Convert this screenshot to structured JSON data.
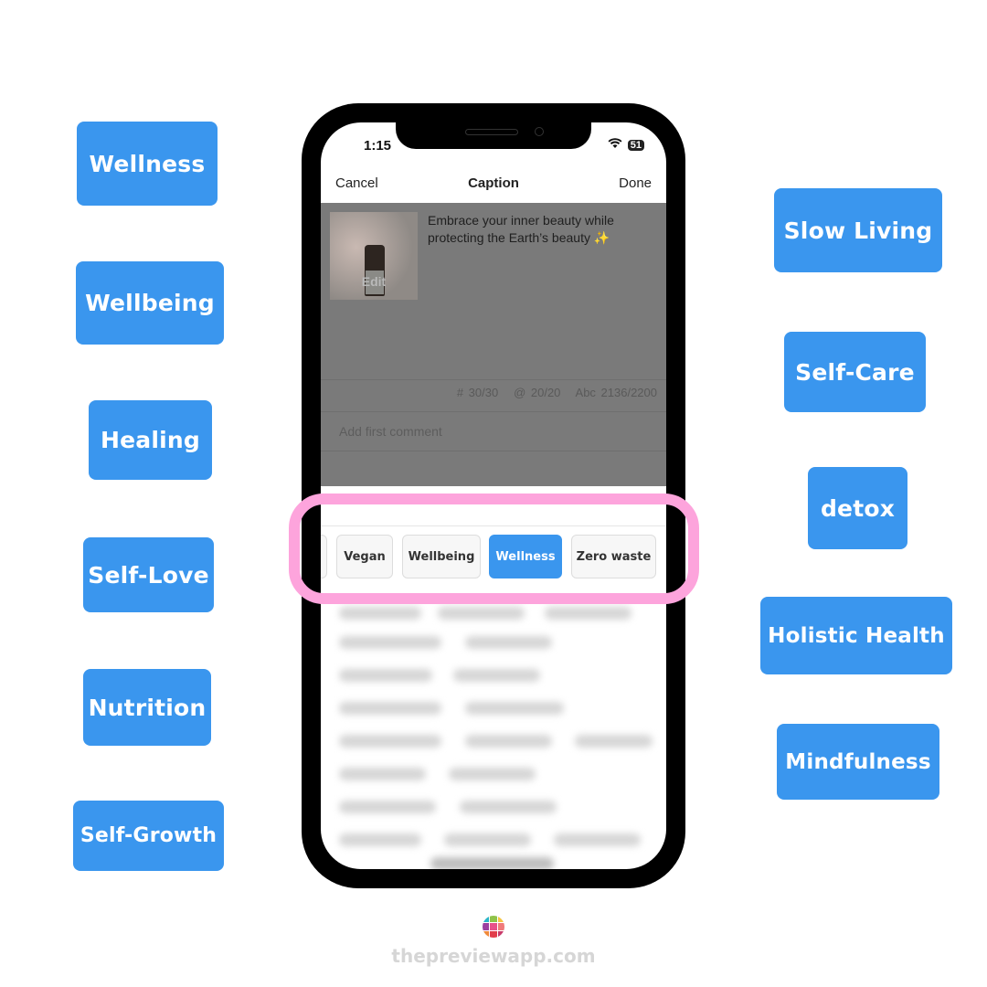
{
  "accent_color": "#3a96ee",
  "highlight_color": "#fda4dc",
  "left_tags": [
    "Wellness",
    "Wellbeing",
    "Healing",
    "Self-Love",
    "Nutrition",
    "Self-Growth"
  ],
  "right_tags": [
    "Slow Living",
    "Self-Care",
    "detox",
    "Holistic Health",
    "Mindfulness"
  ],
  "phone": {
    "time": "1:15",
    "battery": "51",
    "nav": {
      "cancel": "Cancel",
      "title": "Caption",
      "done": "Done"
    },
    "thumbnail_edit": "Edit",
    "caption": "Embrace your inner beauty while protecting the Earth’s beauty ✨",
    "counters": {
      "hashtags": "# 30/30",
      "mentions": "@ 20/20",
      "characters": "Abc 2136/2200"
    },
    "comment_placeholder": "Add first comment",
    "chips": [
      {
        "label": "Vegan",
        "selected": false
      },
      {
        "label": "Wellbeing",
        "selected": false
      },
      {
        "label": "Wellness",
        "selected": true
      },
      {
        "label": "Zero waste",
        "selected": false
      }
    ]
  },
  "footer": {
    "site": "thepreviewapp.com",
    "logo_colors": [
      "#2bb5c8",
      "#8fc34a",
      "#f5c542",
      "#9b3fa0",
      "#e8508a",
      "#f07a7a",
      "#f08a3c",
      "#e23c4a",
      "#c93a6a"
    ]
  }
}
